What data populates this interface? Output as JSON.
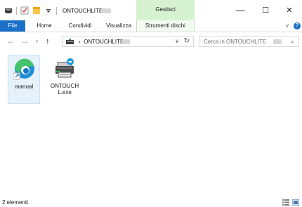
{
  "window": {
    "title": "ONTOUCHLITE",
    "context_tab_group": "Gestisci",
    "controls": {
      "minimize": "—",
      "maximize": "☐",
      "close": "✕"
    }
  },
  "ribbon": {
    "tabs": [
      {
        "label": "File"
      },
      {
        "label": "Home"
      },
      {
        "label": "Condividi"
      },
      {
        "label": "Visualizza"
      },
      {
        "label": "Strumenti dischi"
      }
    ],
    "collapse_glyph": "∨",
    "help_glyph": "?"
  },
  "navigation": {
    "back": "←",
    "forward": "→",
    "recent": "∨",
    "up": "↑",
    "breadcrumb_separator": "›",
    "breadcrumb": "ONTOUCHLITE",
    "dropdown": "∨",
    "refresh": "↻",
    "search_placeholder": "Cerca in ONTOUCHLITE",
    "search_icon": "⌕"
  },
  "items": [
    {
      "label": "manual",
      "icon": "edge-browser-icon",
      "selected": true
    },
    {
      "label": "ONTOUCH L.exe",
      "icon": "printer-app-icon",
      "selected": false
    }
  ],
  "status": {
    "count": "2 elementi"
  },
  "colors": {
    "file_tab": "#1a70c8",
    "context_tab": "#d7f2d0",
    "selection": "#e5f1fb"
  }
}
